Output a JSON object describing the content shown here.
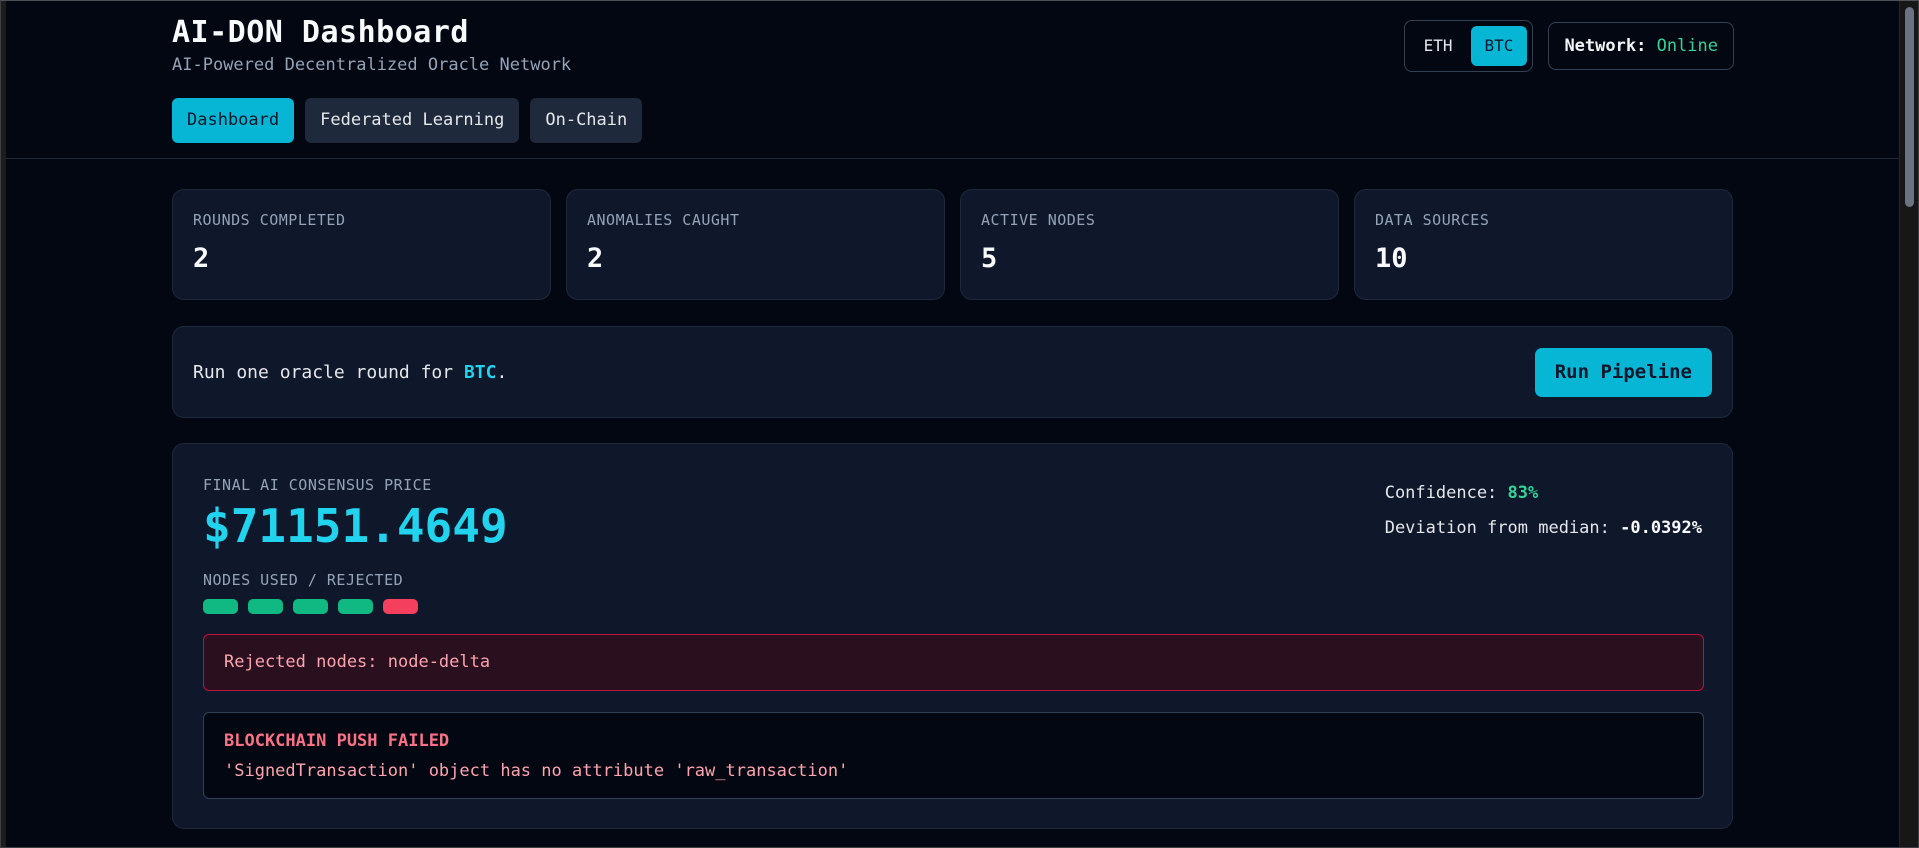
{
  "header": {
    "title": "AI-DON Dashboard",
    "subtitle": "AI-Powered Decentralized Oracle Network",
    "tabs": [
      {
        "label": "Dashboard",
        "active": true
      },
      {
        "label": "Federated Learning",
        "active": false
      },
      {
        "label": "On-Chain",
        "active": false
      }
    ],
    "asset_toggle": {
      "options": [
        "ETH",
        "BTC"
      ],
      "selected": "BTC"
    },
    "network": {
      "label": "Network:",
      "value": "Online"
    }
  },
  "stats": [
    {
      "label": "ROUNDS COMPLETED",
      "value": "2"
    },
    {
      "label": "ANOMALIES CAUGHT",
      "value": "2"
    },
    {
      "label": "ACTIVE NODES",
      "value": "5"
    },
    {
      "label": "DATA SOURCES",
      "value": "10"
    }
  ],
  "pipeline": {
    "text_prefix": "Run one oracle round for ",
    "asset": "BTC",
    "text_suffix": ".",
    "button_label": "Run Pipeline"
  },
  "consensus": {
    "label": "FINAL AI CONSENSUS PRICE",
    "price": "$71151.4649",
    "confidence_label": "Confidence: ",
    "confidence_value": "83%",
    "deviation_label": "Deviation from median: ",
    "deviation_value": "-0.0392%",
    "nodes_label": "NODES USED / REJECTED",
    "nodes": [
      "used",
      "used",
      "used",
      "used",
      "rejected"
    ],
    "rejected_text": "Rejected nodes: node-delta",
    "error_title": "BLOCKCHAIN PUSH FAILED",
    "error_detail": "'SignedTransaction' object has no attribute 'raw_transaction'"
  },
  "colors": {
    "accent": "#06b6d4",
    "success": "#10b981",
    "danger": "#f43f5e",
    "background": "#030712",
    "panel": "#0f172a"
  }
}
